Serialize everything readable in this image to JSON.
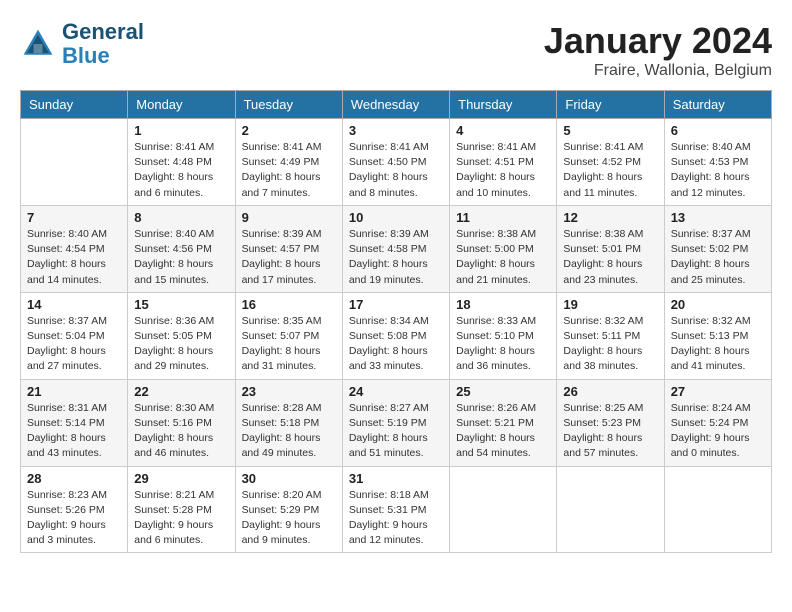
{
  "header": {
    "logo_line1": "General",
    "logo_line2": "Blue",
    "month": "January 2024",
    "location": "Fraire, Wallonia, Belgium"
  },
  "weekdays": [
    "Sunday",
    "Monday",
    "Tuesday",
    "Wednesday",
    "Thursday",
    "Friday",
    "Saturday"
  ],
  "weeks": [
    [
      {
        "day": "",
        "info": ""
      },
      {
        "day": "1",
        "info": "Sunrise: 8:41 AM\nSunset: 4:48 PM\nDaylight: 8 hours\nand 6 minutes."
      },
      {
        "day": "2",
        "info": "Sunrise: 8:41 AM\nSunset: 4:49 PM\nDaylight: 8 hours\nand 7 minutes."
      },
      {
        "day": "3",
        "info": "Sunrise: 8:41 AM\nSunset: 4:50 PM\nDaylight: 8 hours\nand 8 minutes."
      },
      {
        "day": "4",
        "info": "Sunrise: 8:41 AM\nSunset: 4:51 PM\nDaylight: 8 hours\nand 10 minutes."
      },
      {
        "day": "5",
        "info": "Sunrise: 8:41 AM\nSunset: 4:52 PM\nDaylight: 8 hours\nand 11 minutes."
      },
      {
        "day": "6",
        "info": "Sunrise: 8:40 AM\nSunset: 4:53 PM\nDaylight: 8 hours\nand 12 minutes."
      }
    ],
    [
      {
        "day": "7",
        "info": "Sunrise: 8:40 AM\nSunset: 4:54 PM\nDaylight: 8 hours\nand 14 minutes."
      },
      {
        "day": "8",
        "info": "Sunrise: 8:40 AM\nSunset: 4:56 PM\nDaylight: 8 hours\nand 15 minutes."
      },
      {
        "day": "9",
        "info": "Sunrise: 8:39 AM\nSunset: 4:57 PM\nDaylight: 8 hours\nand 17 minutes."
      },
      {
        "day": "10",
        "info": "Sunrise: 8:39 AM\nSunset: 4:58 PM\nDaylight: 8 hours\nand 19 minutes."
      },
      {
        "day": "11",
        "info": "Sunrise: 8:38 AM\nSunset: 5:00 PM\nDaylight: 8 hours\nand 21 minutes."
      },
      {
        "day": "12",
        "info": "Sunrise: 8:38 AM\nSunset: 5:01 PM\nDaylight: 8 hours\nand 23 minutes."
      },
      {
        "day": "13",
        "info": "Sunrise: 8:37 AM\nSunset: 5:02 PM\nDaylight: 8 hours\nand 25 minutes."
      }
    ],
    [
      {
        "day": "14",
        "info": "Sunrise: 8:37 AM\nSunset: 5:04 PM\nDaylight: 8 hours\nand 27 minutes."
      },
      {
        "day": "15",
        "info": "Sunrise: 8:36 AM\nSunset: 5:05 PM\nDaylight: 8 hours\nand 29 minutes."
      },
      {
        "day": "16",
        "info": "Sunrise: 8:35 AM\nSunset: 5:07 PM\nDaylight: 8 hours\nand 31 minutes."
      },
      {
        "day": "17",
        "info": "Sunrise: 8:34 AM\nSunset: 5:08 PM\nDaylight: 8 hours\nand 33 minutes."
      },
      {
        "day": "18",
        "info": "Sunrise: 8:33 AM\nSunset: 5:10 PM\nDaylight: 8 hours\nand 36 minutes."
      },
      {
        "day": "19",
        "info": "Sunrise: 8:32 AM\nSunset: 5:11 PM\nDaylight: 8 hours\nand 38 minutes."
      },
      {
        "day": "20",
        "info": "Sunrise: 8:32 AM\nSunset: 5:13 PM\nDaylight: 8 hours\nand 41 minutes."
      }
    ],
    [
      {
        "day": "21",
        "info": "Sunrise: 8:31 AM\nSunset: 5:14 PM\nDaylight: 8 hours\nand 43 minutes."
      },
      {
        "day": "22",
        "info": "Sunrise: 8:30 AM\nSunset: 5:16 PM\nDaylight: 8 hours\nand 46 minutes."
      },
      {
        "day": "23",
        "info": "Sunrise: 8:28 AM\nSunset: 5:18 PM\nDaylight: 8 hours\nand 49 minutes."
      },
      {
        "day": "24",
        "info": "Sunrise: 8:27 AM\nSunset: 5:19 PM\nDaylight: 8 hours\nand 51 minutes."
      },
      {
        "day": "25",
        "info": "Sunrise: 8:26 AM\nSunset: 5:21 PM\nDaylight: 8 hours\nand 54 minutes."
      },
      {
        "day": "26",
        "info": "Sunrise: 8:25 AM\nSunset: 5:23 PM\nDaylight: 8 hours\nand 57 minutes."
      },
      {
        "day": "27",
        "info": "Sunrise: 8:24 AM\nSunset: 5:24 PM\nDaylight: 9 hours\nand 0 minutes."
      }
    ],
    [
      {
        "day": "28",
        "info": "Sunrise: 8:23 AM\nSunset: 5:26 PM\nDaylight: 9 hours\nand 3 minutes."
      },
      {
        "day": "29",
        "info": "Sunrise: 8:21 AM\nSunset: 5:28 PM\nDaylight: 9 hours\nand 6 minutes."
      },
      {
        "day": "30",
        "info": "Sunrise: 8:20 AM\nSunset: 5:29 PM\nDaylight: 9 hours\nand 9 minutes."
      },
      {
        "day": "31",
        "info": "Sunrise: 8:18 AM\nSunset: 5:31 PM\nDaylight: 9 hours\nand 12 minutes."
      },
      {
        "day": "",
        "info": ""
      },
      {
        "day": "",
        "info": ""
      },
      {
        "day": "",
        "info": ""
      }
    ]
  ]
}
